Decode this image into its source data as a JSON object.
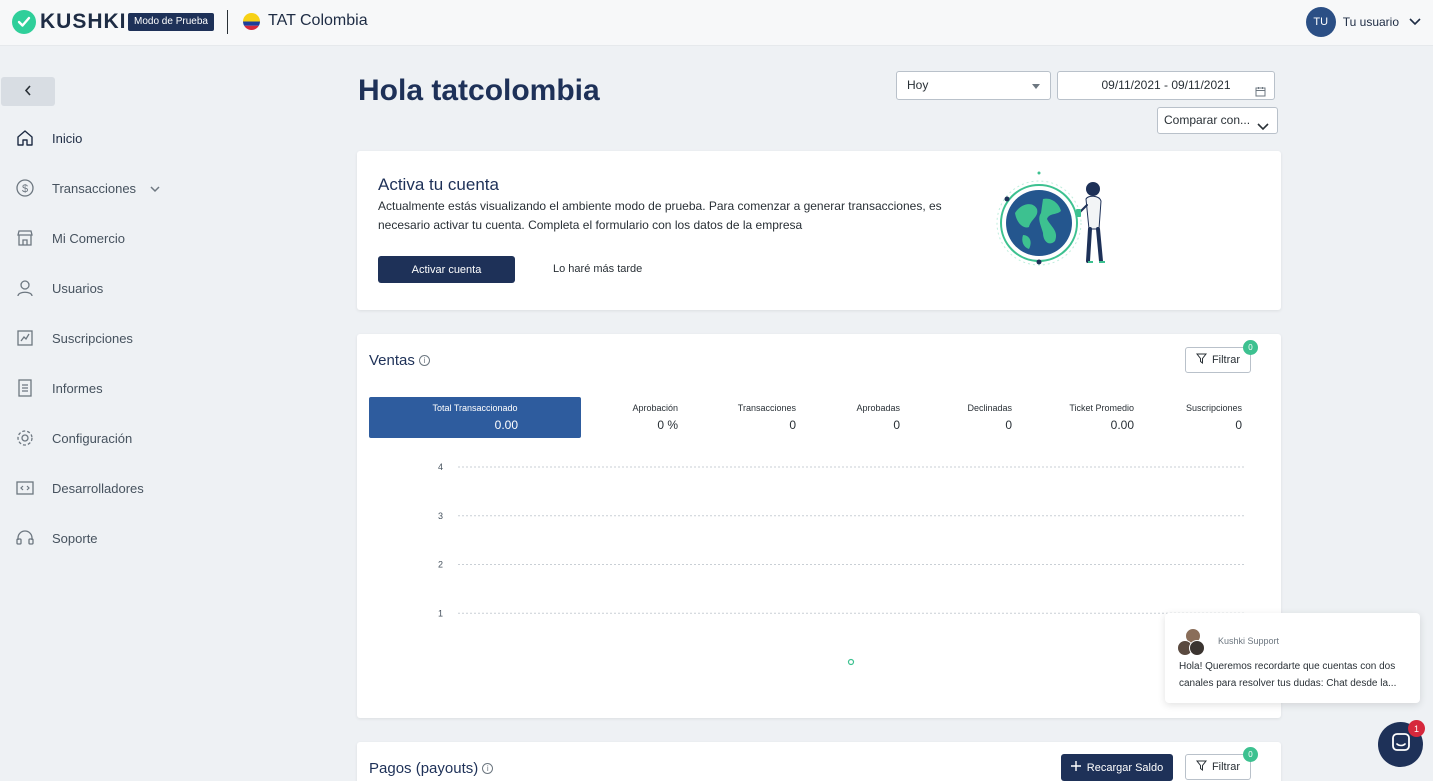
{
  "header": {
    "brand": "KUSHKI",
    "env_badge": "Modo de Prueba",
    "merchant_name": "TAT Colombia",
    "user_initials": "TU",
    "user_name": "Tu usuario"
  },
  "sidebar": {
    "items": [
      {
        "label": "Inicio",
        "icon": "home-icon"
      },
      {
        "label": "Transacciones",
        "icon": "dollar-circle-icon"
      },
      {
        "label": "Mi Comercio",
        "icon": "store-icon"
      },
      {
        "label": "Usuarios",
        "icon": "user-icon"
      },
      {
        "label": "Suscripciones",
        "icon": "subscription-icon"
      },
      {
        "label": "Informes",
        "icon": "report-icon"
      },
      {
        "label": "Configuración",
        "icon": "gear-icon"
      },
      {
        "label": "Desarrolladores",
        "icon": "code-icon"
      },
      {
        "label": "Soporte",
        "icon": "headset-icon"
      }
    ]
  },
  "main": {
    "greeting": "Hola tatcolombia",
    "period_select": "Hoy",
    "date_range": "09/11/2021 - 09/11/2021",
    "compare_select": "Comparar con..."
  },
  "activate": {
    "title": "Activa tu cuenta",
    "description": "Actualmente estás visualizando el ambiente modo de prueba. Para comenzar a generar transacciones, es necesario activar tu cuenta. Completa el formulario con los datos de la empresa",
    "primary_label": "Activar cuenta",
    "later_label": "Lo haré más tarde"
  },
  "sales": {
    "title": "Ventas",
    "filter_label": "Filtrar",
    "filter_count": "0",
    "kpis": [
      {
        "label": "Total Transaccionado",
        "value": "0.00"
      },
      {
        "label": "Aprobación",
        "value": "0 %"
      },
      {
        "label": "Transacciones",
        "value": "0"
      },
      {
        "label": "Aprobadas",
        "value": "0"
      },
      {
        "label": "Declinadas",
        "value": "0"
      },
      {
        "label": "Ticket Promedio",
        "value": "0.00"
      },
      {
        "label": "Suscripciones",
        "value": "0"
      }
    ]
  },
  "chart_data": {
    "type": "line",
    "y_ticks": [
      "4",
      "3",
      "2",
      "1"
    ],
    "ylim": [
      0,
      4
    ],
    "series": [
      {
        "values": [
          0
        ]
      }
    ],
    "grid": true,
    "accent": "#3dc190"
  },
  "payouts": {
    "title": "Pagos (payouts)",
    "recharge_label": "Recargar Saldo",
    "filter_label": "Filtrar",
    "filter_count": "0"
  },
  "chat": {
    "sender": "Kushki Support",
    "message": "Hola! Queremos recordarte que cuentas con dos canales para resolver tus dudas: Chat desde la...",
    "unread": "1"
  }
}
